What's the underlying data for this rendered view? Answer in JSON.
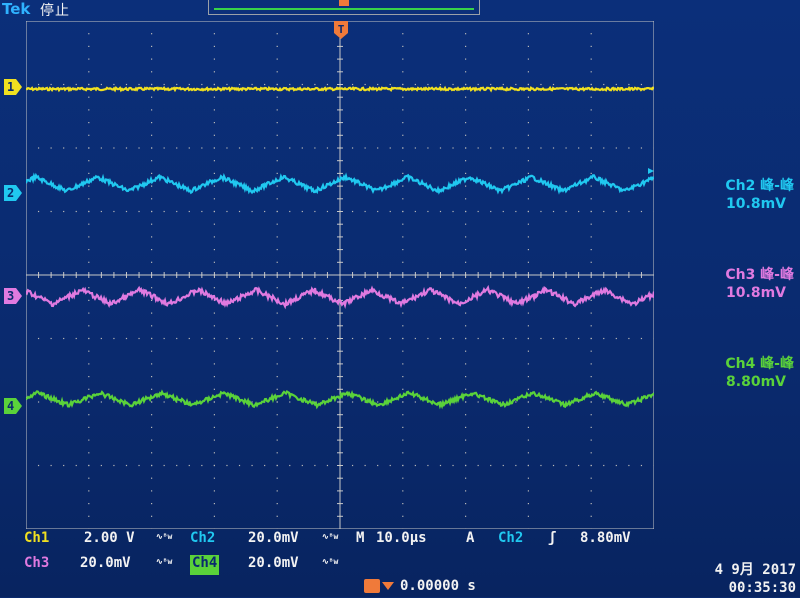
{
  "header": {
    "brand": "Tek",
    "state": "停止"
  },
  "trigger": {
    "marker": "T"
  },
  "channels": [
    {
      "id": "1",
      "color": "#f0e020"
    },
    {
      "id": "2",
      "color": "#20c8f0"
    },
    {
      "id": "3",
      "color": "#e07ae0"
    },
    {
      "id": "4",
      "color": "#5ad23a"
    }
  ],
  "measurements": [
    {
      "title": "Ch2 峰-峰",
      "value": "10.8mV",
      "color": "#20c8f0"
    },
    {
      "title": "Ch3 峰-峰",
      "value": "10.8mV",
      "color": "#e07ae0"
    },
    {
      "title": "Ch4 峰-峰",
      "value": "8.80mV",
      "color": "#5ad23a"
    }
  ],
  "settings": {
    "ch1_label": "Ch1",
    "ch1_scale": "2.00 V",
    "ch2_label": "Ch2",
    "ch2_scale": "20.0mV",
    "ch3_label": "Ch3",
    "ch3_scale": "20.0mV",
    "ch4_label": "Ch4",
    "ch4_scale": "20.0mV",
    "bw_symbol": "∿ᴮw",
    "timebase_label": "M",
    "timebase": "10.0µs",
    "trig_mode": "A",
    "trig_source": "Ch2",
    "trig_slope": "ʃ",
    "trig_level": "8.80mV",
    "trig_position": "0.00000 s"
  },
  "datetime": {
    "date": "4 9月  2017",
    "time": "00:35:30"
  }
}
